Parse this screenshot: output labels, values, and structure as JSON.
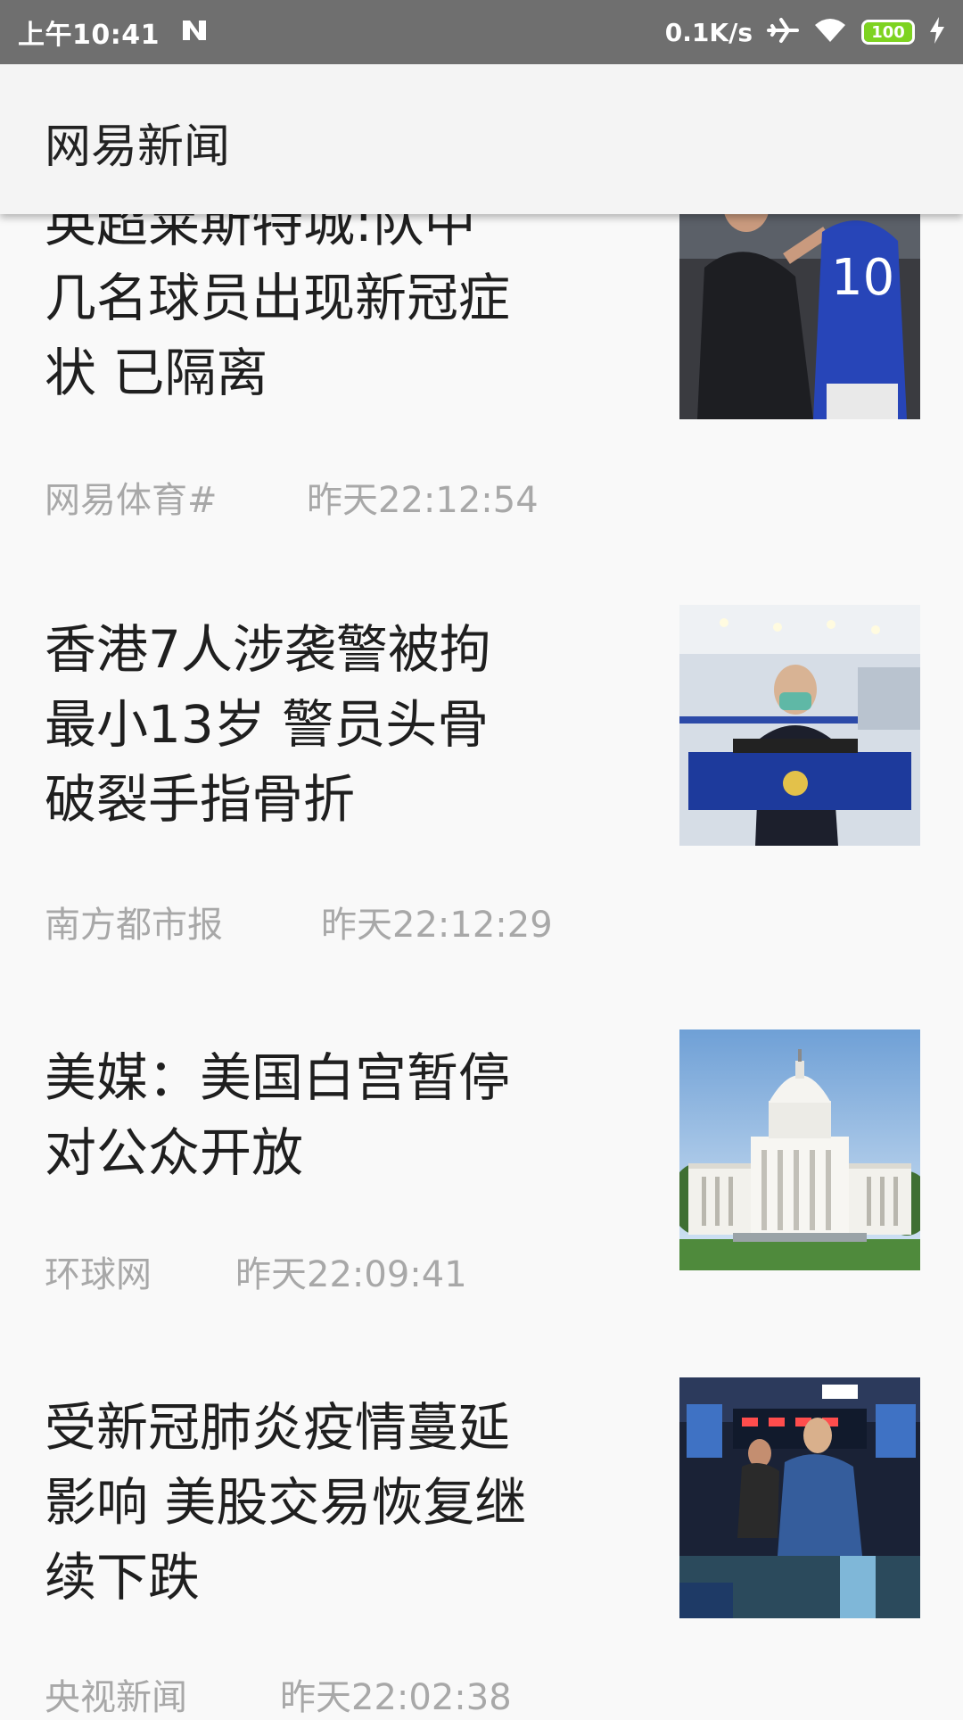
{
  "status_bar": {
    "time": "上午10:41",
    "network_speed": "0.1K/s",
    "battery": "100",
    "battery_level_percent": 100
  },
  "app_bar": {
    "title": "网易新闻"
  },
  "news": [
    {
      "title": "英超莱斯特城:队中\n几名球员出现新冠症\n状 已隔离",
      "source": "网易体育#",
      "time": "昨天22:12:54",
      "thumb_icon": "football-players-photo"
    },
    {
      "title": "香港7人涉袭警被拘\n最小13岁 警员头骨\n破裂手指骨折",
      "source": "南方都市报",
      "time": "昨天22:12:29",
      "thumb_icon": "press-conference-photo"
    },
    {
      "title": "美媒：美国白宫暂停\n对公众开放",
      "source": "环球网",
      "time": "昨天22:09:41",
      "thumb_icon": "capitol-building-photo"
    },
    {
      "title": "受新冠肺炎疫情蔓延\n影响 美股交易恢复继\n续下跌",
      "source": "央视新闻",
      "time": "昨天22:02:38",
      "thumb_icon": "stock-exchange-photo"
    }
  ]
}
